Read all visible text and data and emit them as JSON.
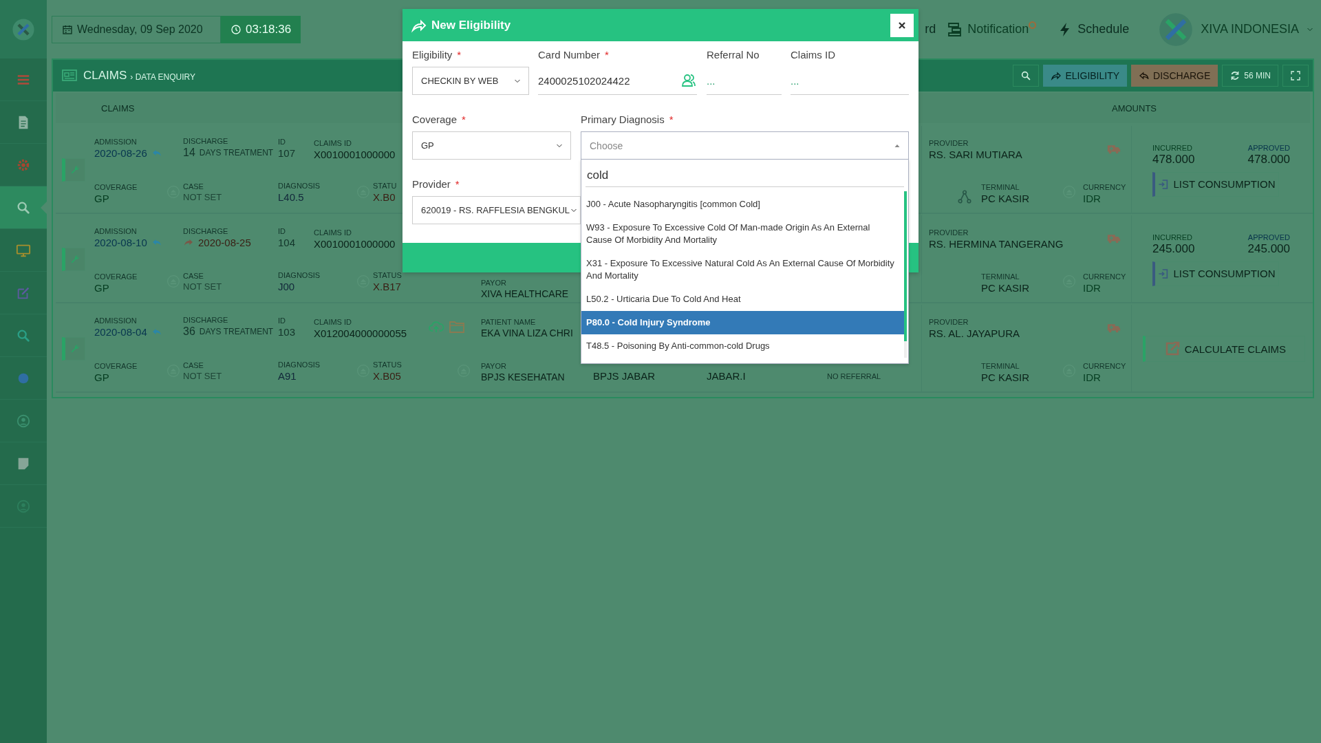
{
  "sidebar": {
    "items": [
      {
        "kind": "menu",
        "color": "#b04a3a",
        "selected": false
      },
      {
        "kind": "document",
        "color": "#8fb3a2",
        "selected": false
      },
      {
        "kind": "gear",
        "color": "#a8452f",
        "selected": false
      },
      {
        "kind": "search",
        "color": "#9ccab3",
        "selected": true
      },
      {
        "kind": "monitor",
        "color": "#a88f2c",
        "selected": false
      },
      {
        "kind": "edit",
        "color": "#5d5aa0",
        "selected": false
      },
      {
        "kind": "search",
        "color": "#2a9f86",
        "selected": false
      },
      {
        "kind": "disc",
        "color": "#2f6ea3",
        "selected": false
      },
      {
        "kind": "user",
        "color": "#3a8f6e",
        "selected": false
      },
      {
        "kind": "note",
        "color": "#86a597",
        "selected": false
      },
      {
        "kind": "user",
        "color": "#2d7f5d",
        "selected": false
      }
    ]
  },
  "header": {
    "date": "Wednesday, 09 Sep 2020",
    "time": "03:18:36",
    "nav": [
      {
        "kind": "text",
        "label": "rd"
      },
      {
        "kind": "notification",
        "label": "Notification",
        "badge": true
      },
      {
        "kind": "schedule",
        "label": "Schedule"
      }
    ],
    "account": {
      "name": "XIVA INDONESIA"
    }
  },
  "panel": {
    "title": "CLAIMS",
    "breadcrumb": "› DATA ENQUIRY",
    "actions": [
      {
        "kind": "search"
      },
      {
        "kind": "eligibility",
        "label": "ELIGIBILITY"
      },
      {
        "kind": "discharge",
        "label": "DISCHARGE"
      },
      {
        "kind": "refresh",
        "label": "56 MIN"
      },
      {
        "kind": "expand"
      }
    ],
    "columns": [
      "CLAIMS",
      "AMOUNTS"
    ],
    "rows": [
      {
        "admission": {
          "label": "ADMISSION",
          "value": "2020-08-26"
        },
        "discharge": {
          "kind": "days",
          "label": "DISCHARGE",
          "value": "14",
          "note": "DAYS TREATMENT"
        },
        "id": {
          "label": "ID",
          "value": "107"
        },
        "claims_id": {
          "label": "CLAIMS ID",
          "value": "X0010001000000"
        },
        "coverage": {
          "label": "COVERAGE",
          "value": "GP"
        },
        "case": {
          "label": "CASE",
          "value": "NOT SET"
        },
        "diagnosis": {
          "label": "DIAGNOSIS",
          "value": "L40.5"
        },
        "status": {
          "label": "STATU",
          "value": "X.B0"
        },
        "provider": {
          "label": "PROVIDER",
          "value": "RS. SARI MUTIARA"
        },
        "terminal": {
          "label": "TERMINAL",
          "value": "PC KASIR",
          "icon": true
        },
        "currency": {
          "label": "CURRENCY",
          "value": "IDR"
        },
        "amounts": {
          "incurred_label": "INCURRED",
          "incurred": "478.000",
          "approved_label": "APPROVED",
          "approved": "478.000"
        },
        "action": {
          "kind": "list",
          "label": "LIST CONSUMPTION"
        }
      },
      {
        "admission": {
          "label": "ADMISSION",
          "value": "2020-08-10"
        },
        "discharge": {
          "kind": "date",
          "label": "DISCHARGE",
          "value": "2020-08-25"
        },
        "id": {
          "label": "ID",
          "value": "104"
        },
        "claims_id": {
          "label": "CLAIMS ID",
          "value": "X0010001000000"
        },
        "coverage": {
          "label": "COVERAGE",
          "value": "GP"
        },
        "case": {
          "label": "CASE",
          "value": "NOT SET"
        },
        "diagnosis": {
          "label": "DIAGNOSIS",
          "value": "J00"
        },
        "status": {
          "label": "STATUS",
          "value": "X.B17"
        },
        "payor": {
          "label": "PAYOR",
          "value": "XIVA HEALTHCARE"
        },
        "provider": {
          "label": "PROVIDER",
          "value": "RS. HERMINA TANGERANG"
        },
        "terminal": {
          "label": "TERMINAL",
          "value": "PC KASIR",
          "icon": false
        },
        "currency": {
          "label": "CURRENCY",
          "value": "IDR"
        },
        "amounts": {
          "incurred_label": "INCURRED",
          "incurred": "245.000",
          "approved_label": "APPROVED",
          "approved": "245.000"
        },
        "action": {
          "kind": "list",
          "label": "LIST CONSUMPTION"
        }
      },
      {
        "admission": {
          "label": "ADMISSION",
          "value": "2020-08-04"
        },
        "discharge": {
          "kind": "days",
          "label": "DISCHARGE",
          "value": "36",
          "note": "DAYS TREATMENT"
        },
        "id": {
          "label": "ID",
          "value": "103"
        },
        "claims_id": {
          "label": "CLAIMS ID",
          "value": "X012004000000055"
        },
        "files": true,
        "coverage": {
          "label": "COVERAGE",
          "value": "GP"
        },
        "case": {
          "label": "CASE",
          "value": "NOT SET"
        },
        "diagnosis": {
          "label": "DIAGNOSIS",
          "value": "A91"
        },
        "status": {
          "label": "STATUS",
          "value": "X.B05"
        },
        "patient": {
          "label": "PATIENT NAME",
          "value": "EKA VINA LIZA CHRI"
        },
        "payor": {
          "label": "PAYOR",
          "value": "BPJS KESEHATAN"
        },
        "details": [
          "BPJS JABAR",
          "JABAR.I"
        ],
        "referral": "NO REFERRAL",
        "provider": {
          "label": "PROVIDER",
          "value": "RS. AL. JAYAPURA"
        },
        "terminal": {
          "label": "TERMINAL",
          "value": "PC KASIR",
          "icon": false
        },
        "currency": {
          "label": "CURRENCY",
          "value": "IDR"
        },
        "action": {
          "kind": "calculate",
          "label": "CALCULATE CLAIMS"
        }
      }
    ]
  },
  "modal": {
    "title": "New Eligibility",
    "fields": [
      {
        "kind": "select",
        "label": "Eligibility",
        "required": "*",
        "value": "CHECKIN BY WEB"
      },
      {
        "kind": "lookup",
        "label": "Card Number",
        "required": "*",
        "value": "2400025102024422"
      },
      {
        "kind": "text",
        "label": "Referral No",
        "placeholder": "..."
      },
      {
        "kind": "text",
        "label": "Claims ID",
        "placeholder": "..."
      },
      {
        "kind": "select",
        "label": "Coverage",
        "required": "*",
        "value": "GP"
      },
      {
        "kind": "combo",
        "label": "Primary Diagnosis",
        "required": "*",
        "placeholder": "Choose",
        "expanded": true
      },
      {
        "kind": "select",
        "label": "Provider",
        "required": "*",
        "value": "620019 - RS. RAFFLESIA BENGKUL"
      }
    ],
    "dropdown": {
      "search": "cold",
      "options": [
        {
          "label": "J00 - Acute Nasopharyngitis [common Cold]",
          "selected": false
        },
        {
          "label": "W93 - Exposure To Excessive Cold Of Man-made Origin As An External Cause Of Morbidity And Mortality",
          "selected": false
        },
        {
          "label": "X31 - Exposure To Excessive Natural Cold As An External Cause Of Morbidity And Mortality",
          "selected": false
        },
        {
          "label": "L50.2 - Urticaria Due To Cold And Heat",
          "selected": false
        },
        {
          "label": "P80.0 - Cold Injury Syndrome",
          "selected": true
        },
        {
          "label": "T48.5 - Poisoning By Anti-common-cold Drugs",
          "selected": false
        }
      ]
    }
  }
}
